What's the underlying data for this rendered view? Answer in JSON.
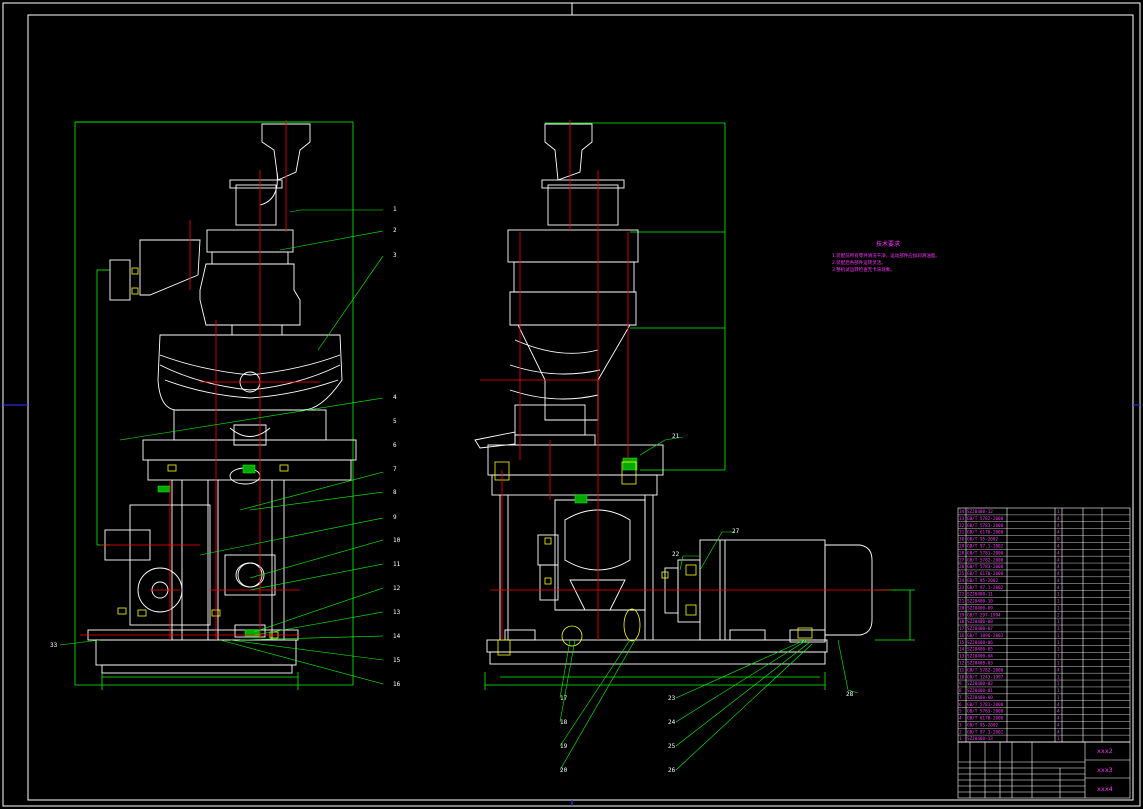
{
  "drawing": {
    "left_balloons": [
      "1",
      "2",
      "3",
      "4",
      "5",
      "6",
      "7",
      "8",
      "9",
      "10",
      "11",
      "12",
      "13",
      "14",
      "15",
      "16"
    ],
    "left_extra_balloon": "33",
    "right_balloons": [
      "21",
      "22",
      "27"
    ],
    "bottom_left_balloons": [
      "17",
      "18",
      "19",
      "20"
    ],
    "bottom_right_balloons": [
      "23",
      "24",
      "25",
      "26"
    ],
    "motor_balloon": "28"
  },
  "tech_requirements": {
    "title": "技术要求",
    "notes": [
      "1.装配前所有零件清洗干净，运动部件应加润滑油脂。",
      "2.装配后各部件运转灵活。",
      "3.整机试运转检查无卡滞现象。"
    ]
  },
  "parts_list": {
    "rows": [
      [
        "34",
        "SZJ0400-12",
        "",
        "1",
        ""
      ],
      [
        "33",
        "GB/T 5782-2000",
        "",
        "4",
        ""
      ],
      [
        "32",
        "GB/T 5783-2000",
        "",
        "4",
        ""
      ],
      [
        "31",
        "GB/T 6170-2000",
        "",
        "4",
        ""
      ],
      [
        "30",
        "GB/T 95-2002",
        "",
        "8",
        ""
      ],
      [
        "29",
        "GB/T 97.1-2002",
        "",
        "4",
        ""
      ],
      [
        "28",
        "GB/T 5781-2000",
        "",
        "4",
        ""
      ],
      [
        "27",
        "GB/T 5782-2000",
        "",
        "4",
        ""
      ],
      [
        "26",
        "GB/T 5783-2000",
        "",
        "4",
        ""
      ],
      [
        "25",
        "GB/T 6170-2000",
        "",
        "4",
        ""
      ],
      [
        "24",
        "GB/T 95-2002",
        "",
        "4",
        ""
      ],
      [
        "23",
        "GB/T 97.1-2002",
        "",
        "4",
        ""
      ],
      [
        "22",
        "SZJ0400-11",
        "",
        "1",
        ""
      ],
      [
        "21",
        "SZJ0400-10",
        "",
        "1",
        ""
      ],
      [
        "20",
        "SZJ0400-09",
        "",
        "1",
        ""
      ],
      [
        "19",
        "GB/T 297-1994",
        "",
        "2",
        ""
      ],
      [
        "18",
        "SZJ0400-08",
        "",
        "1",
        ""
      ],
      [
        "17",
        "SZJ0400-07",
        "",
        "1",
        ""
      ],
      [
        "16",
        "GB/T 1096-2003",
        "",
        "1",
        ""
      ],
      [
        "15",
        "SZJ0400-06",
        "",
        "1",
        ""
      ],
      [
        "14",
        "SZJ0400-05",
        "",
        "1",
        ""
      ],
      [
        "13",
        "SZJ0400-04",
        "",
        "1",
        ""
      ],
      [
        "12",
        "SZJ0400-03",
        "",
        "1",
        ""
      ],
      [
        "11",
        "GB/T 5782-2000",
        "",
        "4",
        ""
      ],
      [
        "10",
        "GB/T 1243-1997",
        "",
        "1",
        ""
      ],
      [
        "9",
        "SZJ0400-02",
        "",
        "1",
        ""
      ],
      [
        "8",
        "SZJ0400-01",
        "",
        "1",
        ""
      ],
      [
        "7",
        "SZJ0400-00",
        "",
        "1",
        ""
      ],
      [
        "6",
        "GB/T 5781-2000",
        "",
        "4",
        ""
      ],
      [
        "5",
        "GB/T 5783-2000",
        "",
        "4",
        ""
      ],
      [
        "4",
        "GB/T 6170-2000",
        "",
        "4",
        ""
      ],
      [
        "3",
        "GB/T 95-2002",
        "",
        "4",
        ""
      ],
      [
        "2",
        "GB/T 97.1-2002",
        "",
        "4",
        ""
      ],
      [
        "1",
        "SZJ0400-13",
        "",
        "1",
        ""
      ]
    ]
  },
  "title_block": {
    "line1": "xxx2",
    "line2": "xxx3",
    "line3": "xxx4"
  },
  "colors": {
    "background": "#000000",
    "frame": "#ffffff",
    "dimension": "#00ff00",
    "center_line": "#ff0000",
    "annotation": "#ff33ff",
    "marker": "#3333ff"
  }
}
